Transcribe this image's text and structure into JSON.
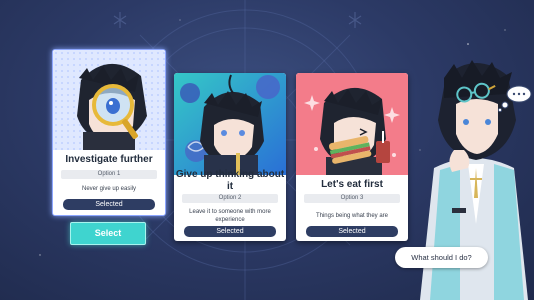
{
  "cards": [
    {
      "title": "Investigate further",
      "option": "Option 1",
      "description": "Never give up easily",
      "status": "Selected",
      "art": "magnifying-glass-portrait",
      "accent": "#7fa4f5"
    },
    {
      "title": "Give up thinking about it",
      "option": "Option 2",
      "description": "Leave it to someone with more experience",
      "status": "Selected",
      "art": "dazed-portrait",
      "accent": "#3cc3c9"
    },
    {
      "title": "Let's eat first",
      "option": "Option 3",
      "description": "Things being what they are",
      "status": "Selected",
      "art": "sandwich-portrait",
      "accent": "#f07a88"
    }
  ],
  "select_button": {
    "label": "Select"
  },
  "dialogue": {
    "text": "What should I do?"
  },
  "colors": {
    "background": "#2c3a66",
    "status_pill": "#2e3d63",
    "select_button": "#3fd4cf"
  }
}
